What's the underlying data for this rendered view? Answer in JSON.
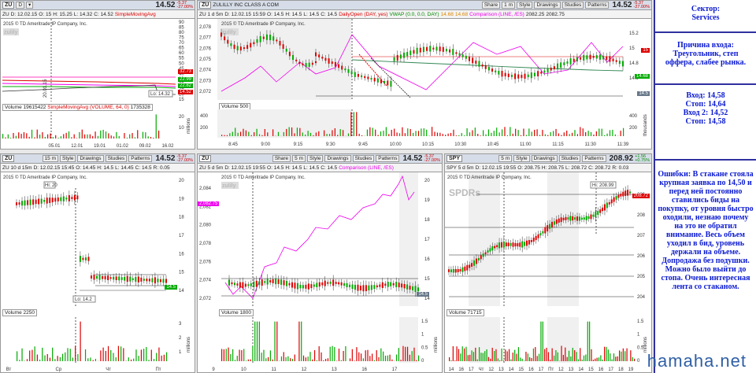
{
  "p1": {
    "sym": "ZU",
    "period": "D",
    "price": "14.52",
    "chg": "-5.37",
    "chgp": "-27.00%",
    "bar2": [
      "ZU",
      "D: 12.02.15",
      "O: 15",
      "H: 15.25",
      "L: 14.32",
      "C: 14.52"
    ],
    "sma": "SimpleMovingAvg",
    "copyright": "2015 © TD Ameritrade IP Company, Inc.",
    "lo": "Lo: 14.32",
    "vol_label": "Volume",
    "vol": "19615422",
    "vol_sma": "SimpleMovingAvg (VOLUME, 64, 0)",
    "vol_sma_val": "1735328",
    "yticks": [
      "90",
      "85",
      "80",
      "75",
      "70",
      "65",
      "60",
      "55",
      "50",
      "45",
      "40",
      "35",
      "30",
      "25",
      "20",
      "15"
    ],
    "vticks": [
      "20",
      "10"
    ],
    "vunit": "millions",
    "xticks": [
      "05.01",
      "12.01",
      "19.01",
      "01.02",
      "09.02",
      "16.02"
    ],
    "tags": [
      "32.73",
      "22.99",
      "22.82",
      "14.52"
    ],
    "side": "20.01.15"
  },
  "p2": {
    "sym": "ZU",
    "period": "1 m",
    "title": "ZULILLY INC CLASS A COM",
    "price": "14.52",
    "chg": "-5.37",
    "chgp": "-27.00%",
    "bar2": [
      "ZU 1 d 5m",
      "D: 12.02.15 15:59",
      "O: 14.5",
      "H: 14.5",
      "L: 14.5",
      "C: 14.5"
    ],
    "daily": "DailyOpen (DAY, yes)",
    "vwap": "VWAP (0.0, 0.0, DAY)",
    "vw1": "14.68",
    "vw2": "14.68",
    "comp": "Comparison (LINE, /ES)",
    "cv1": "2082.25",
    "cv2": "2082.75",
    "yticks": [
      "2,078",
      "2,077",
      "2,076",
      "2,075",
      "2,074",
      "2,073",
      "2,072"
    ],
    "rticks": [
      "15.2",
      "15",
      "14.8",
      "14.6"
    ],
    "tags": [
      "15",
      "14.68",
      "14.5"
    ],
    "vol_label": "Volume",
    "vol": "500",
    "vticks": [
      "400",
      "200"
    ],
    "lvticks": [
      "400",
      "200"
    ],
    "vunit": "thousands",
    "xticks": [
      "8:45",
      "9:00",
      "9:15",
      "9:30",
      "9:45",
      "10:00",
      "10:15",
      "10:30",
      "10:45",
      "11:00",
      "11:15",
      "11:30",
      "11:39"
    ],
    "buttons": [
      "Share",
      "Style",
      "Drawings",
      "Studies",
      "Patterns"
    ]
  },
  "p3": {
    "sym": "ZU",
    "period": "15 m",
    "price": "14.52",
    "chg": "-5.37",
    "chgp": "-27.00%",
    "bar2": [
      "ZU 10 d 15m",
      "D: 12.02.15 15:45",
      "O: 14.45",
      "H: 14.5",
      "L: 14.45",
      "C: 14.5",
      "R: 0.05"
    ],
    "copyright": "2015 © TD Ameritrade IP Company, Inc.",
    "hi": "Hi: 20",
    "lo": "Lo: 14.2",
    "tag": "14.5",
    "yticks": [
      "20",
      "19",
      "18",
      "17",
      "16",
      "15",
      "14"
    ],
    "vol_label": "Volume",
    "vol": "2250",
    "vticks": [
      "3",
      "2",
      "1"
    ],
    "vunit": "millions",
    "xticks": [
      "Вт",
      "Ср",
      "Чт",
      "Пт"
    ],
    "buttons": [
      "Style",
      "Drawings",
      "Studies",
      "Patterns"
    ]
  },
  "p4": {
    "sym": "ZU",
    "period": "5 m",
    "price": "14.52",
    "chg": "-5.37",
    "chgp": "-27.00%",
    "bar2": [
      "ZU 5 d 5m",
      "D: 12.02.15 19:55",
      "O: 14.5",
      "H: 14.5",
      "L: 14.5",
      "C: 14.5"
    ],
    "comp": "Comparison (LINE, /ES)",
    "copyright": "2015 © TD Ameritrade IP Company, Inc.",
    "yticks": [
      "2,084",
      "2,082",
      "2,080",
      "2,078",
      "2,076",
      "2,074",
      "2,072"
    ],
    "rticks": [
      "20",
      "19",
      "18",
      "17",
      "16",
      "15",
      "14"
    ],
    "ltag": "2,082.75",
    "tag": "14.5",
    "vol_label": "Volume",
    "vol": "1800",
    "vticks": [
      "1.5",
      "1",
      "0.5",
      "0"
    ],
    "vunit": "millions",
    "xticks": [
      "9",
      "10",
      "11",
      "12",
      "13",
      "16",
      "17"
    ],
    "buttons": [
      "Share",
      "Style",
      "Drawings",
      "Studies",
      "Patterns"
    ]
  },
  "p5": {
    "sym": "SPY",
    "period": "5 m",
    "price": "208.92",
    "chg": "+1.56",
    "chgp": "+0.75%",
    "bar2": [
      "SPY 5 d 5m",
      "D: 12.02.15 19:55",
      "O: 208.75",
      "H: 208.75",
      "L: 208.72",
      "C: 208.72",
      "R: 0.03"
    ],
    "copyright": "2015 © TD Ameritrade IP Company, Inc.",
    "wm": "SPDRs",
    "hi": "Hi: 208.99",
    "tag": "208.72",
    "yticks": [
      "209",
      "208",
      "207",
      "206",
      "205",
      "204"
    ],
    "vol_label": "Volume",
    "vol": "71715",
    "vticks": [
      "1.5",
      "1",
      "0.5",
      "0"
    ],
    "vunit": "millions",
    "xticks": [
      "14",
      "16",
      "17",
      "Чт",
      "12",
      "13",
      "14",
      "15",
      "16",
      "17",
      "Пт",
      "12",
      "13",
      "14",
      "15",
      "16",
      "17",
      "18",
      "19"
    ],
    "buttons": [
      "Style",
      "Drawings",
      "Studies",
      "Patterns"
    ]
  },
  "info": {
    "sector": "Сектор:\nServices",
    "reason": "Причина входа:\nТреугольник, степ оффера, слабее рынка.",
    "levels": "Вход: 14,58\nСтоп: 14,64\nВход 2: 14,52\nСтоп: 14,58",
    "errors": "Ошибки: В стакане стояла крупная заявка по 14,50  и перед ней постоянно ставились биды на покупку, от уровня быстро оходили, незнаю почему на это не обратил внимание. Весь объем уходил в бид, уровень держали на объеме. Допродажа без подушки. Можно было выйти до стопа. Очень интересная лента со стаканом."
  },
  "brand": "hamaha.net"
}
